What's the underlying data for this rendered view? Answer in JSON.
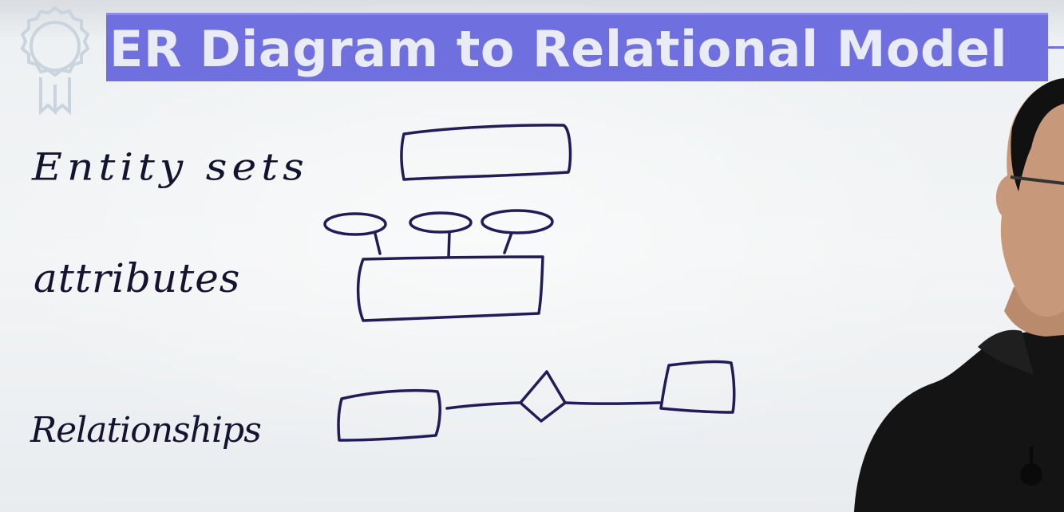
{
  "title": "ER Diagram to Relational Model",
  "labels": {
    "entity_sets": "Entity sets",
    "attributes": "attributes",
    "relationships": "Relationships"
  },
  "colors": {
    "banner": "#6f6fe0",
    "banner_text": "#e9ecf5",
    "marker_ink": "#231a5a",
    "board": "#f2f4f5"
  },
  "icons": {
    "logo": "award-ribbon-badge-icon"
  }
}
